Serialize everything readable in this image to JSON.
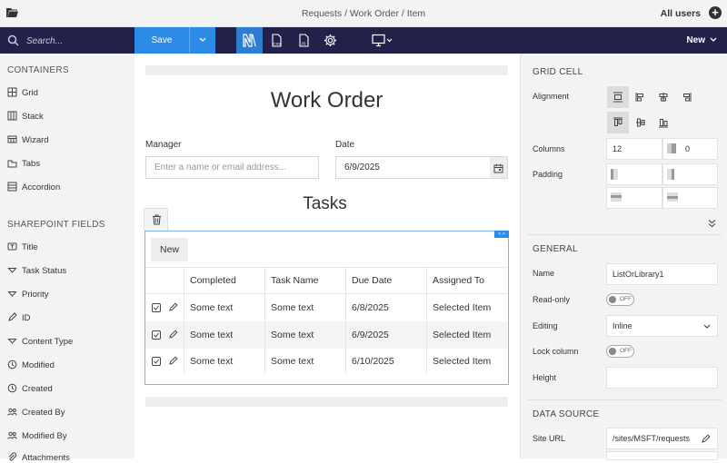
{
  "topbar": {
    "breadcrumb": "Requests / Work Order / Item",
    "users_label": "All users",
    "add_symbol": "+"
  },
  "toolbar": {
    "search_placeholder": "Search...",
    "save_label": "Save",
    "new_label": "New"
  },
  "left": {
    "containers_header": "CONTAINERS",
    "containers": [
      "Grid",
      "Stack",
      "Wizard",
      "Tabs",
      "Accordion"
    ],
    "fields_header": "SHAREPOINT FIELDS",
    "fields": [
      "Title",
      "Task Status",
      "Priority",
      "ID",
      "Content Type",
      "Modified",
      "Created",
      "Created By",
      "Modified By",
      "Attachments"
    ]
  },
  "form": {
    "title": "Work Order",
    "manager_label": "Manager",
    "manager_placeholder": "Enter a name or email address...",
    "date_label": "Date",
    "date_value": "6/9/2025",
    "tasks_title": "Tasks",
    "grid_tag": "<·>",
    "new_button": "New",
    "columns": [
      "Completed",
      "Task Name",
      "Due Date",
      "Assigned To"
    ],
    "rows": [
      {
        "completed": "Some text",
        "task": "Some text",
        "due": "6/8/2025",
        "assigned": "Selected Item"
      },
      {
        "completed": "Some text",
        "task": "Some text",
        "due": "6/9/2025",
        "assigned": "Selected Item"
      },
      {
        "completed": "Some text",
        "task": "Some text",
        "due": "6/10/2025",
        "assigned": "Selected Item"
      }
    ]
  },
  "right": {
    "grid_cell_header": "GRID CELL",
    "alignment_label": "Alignment",
    "columns_label": "Columns",
    "columns_value": "12",
    "columns_offset": "0",
    "padding_label": "Padding",
    "general_header": "GENERAL",
    "name_label": "Name",
    "name_value": "ListOrLibrary1",
    "readonly_label": "Read-only",
    "readonly_value": "OFF",
    "editing_label": "Editing",
    "editing_value": "Inline",
    "lock_label": "Lock column",
    "lock_value": "OFF",
    "height_label": "Height",
    "datasource_header": "DATA SOURCE",
    "siteurl_label": "Site URL",
    "siteurl_value": "/sites/MSFT/requests"
  },
  "colors": {
    "toolbar_bg": "#23214a",
    "accent": "#2b8be6",
    "panel_bg": "#f3f3f3"
  }
}
